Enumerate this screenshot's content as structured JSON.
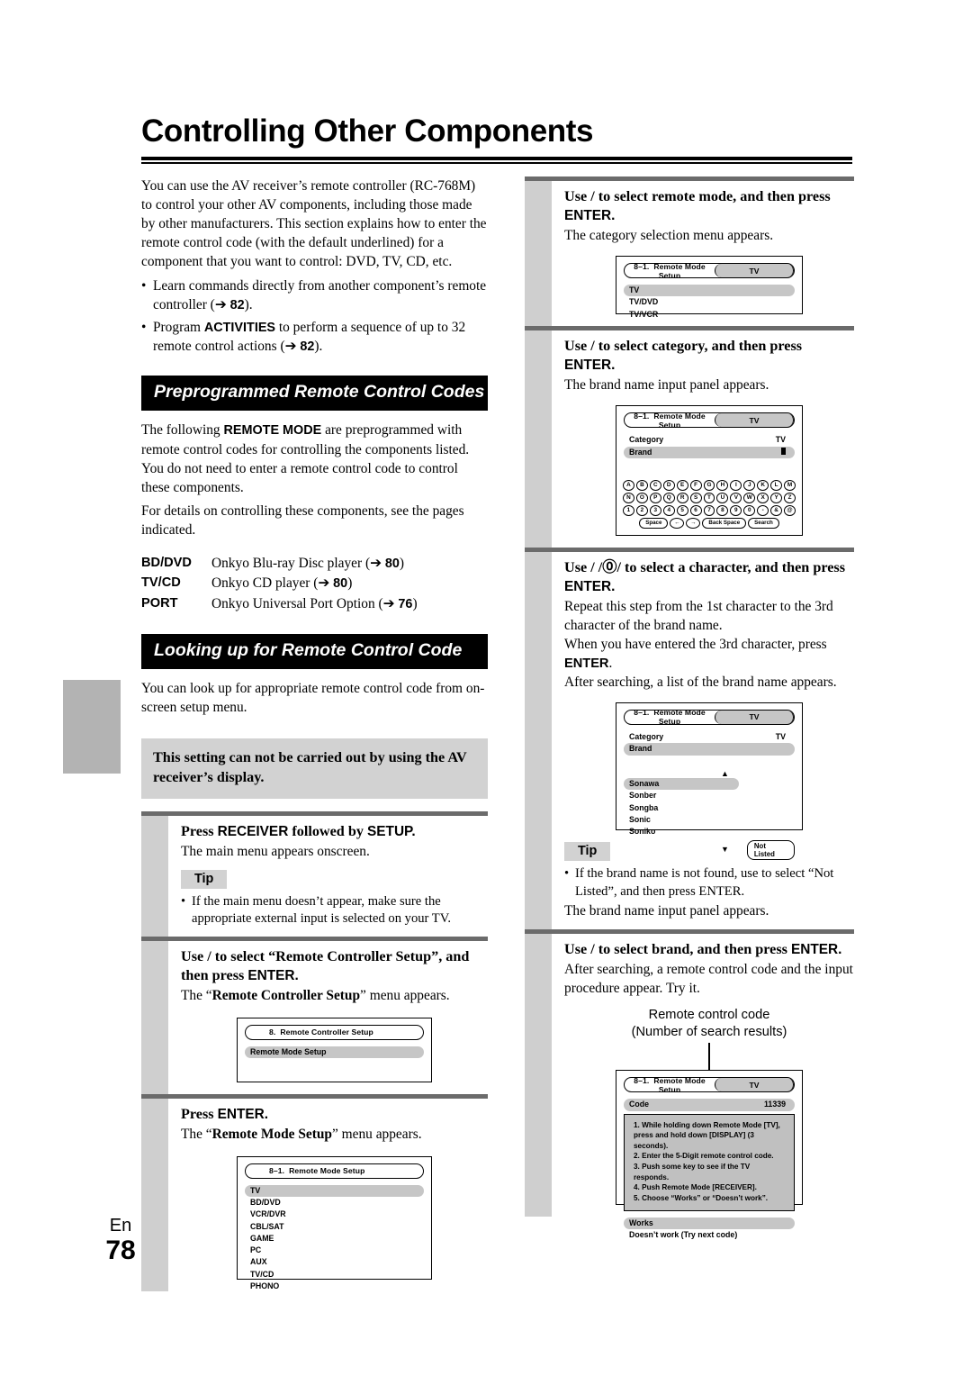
{
  "page": {
    "title": "Controlling Other Components",
    "footer_lang": "En",
    "footer_number": "78"
  },
  "intro": {
    "paragraph": "You can use the AV receiver’s remote controller (RC-768M) to control your other AV components, including those made by other manufacturers. This section explains how to enter the remote control code (with the default underlined) for a component that you want to control: DVD, TV, CD, etc.",
    "bullets": [
      {
        "text_before": "Learn commands directly from another component’s remote controller (",
        "arrow": "➔",
        "page": "82",
        "text_after": ")."
      },
      {
        "text_before": "Program ",
        "bold": "ACTIVITIES",
        "text_mid": " to perform a sequence of up to 32 remote control actions (",
        "arrow": "➔",
        "page": "82",
        "text_after": ")."
      }
    ]
  },
  "section_preprogrammed": {
    "heading": "Preprogrammed Remote Control Codes",
    "p1_a": "The following ",
    "p1_b": "REMOTE MODE",
    "p1_c": " are preprogrammed with remote control codes for controlling the components listed. You do not need to enter a remote control code to control these components.",
    "p2": "For details on controlling these components, see the pages indicated.",
    "modes": [
      {
        "key": "BD/DVD",
        "desc": "Onkyo Blu-ray Disc player (",
        "arrow": "➔",
        "page": "80",
        "close": ")"
      },
      {
        "key": "TV/CD",
        "desc": "Onkyo CD player (",
        "arrow": "➔",
        "page": "80",
        "close": ")"
      },
      {
        "key": "PORT",
        "desc": "Onkyo Universal Port Option (",
        "arrow": "➔",
        "page": "76",
        "close": ")"
      }
    ]
  },
  "section_lookup": {
    "heading": "Looking up for Remote Control Code",
    "intro": "You can look up for appropriate remote control code from on-screen setup menu.",
    "note": "This setting can not be carried out by using the AV receiver’s display."
  },
  "steps": {
    "step1": {
      "title_a": "Press ",
      "title_b": "RECEIVER",
      "title_c": " followed by ",
      "title_d": "SETUP.",
      "body": "The main menu appears onscreen.",
      "tip_label": "Tip",
      "tip_items": [
        "If the main menu doesn’t appear, make sure the appropriate external input is selected on your TV."
      ]
    },
    "step2": {
      "title_a": "Use   /   to select “Remote Controller Setup”, and then press ",
      "title_b": "ENTER.",
      "body_a": "The “",
      "body_b": "Remote Controller Setup",
      "body_c": "” menu appears.",
      "osd": {
        "header_num": "8.",
        "header_title": "Remote Controller Setup",
        "items": [
          "Remote Mode Setup"
        ]
      }
    },
    "step3": {
      "title_a": "Press ",
      "title_b": "ENTER.",
      "body_a": "The “",
      "body_b": "Remote Mode Setup",
      "body_c": "” menu appears.",
      "osd": {
        "header_num": "8–1.",
        "header_title": "Remote Mode Setup",
        "items": [
          "TV",
          "BD/DVD",
          "VCR/DVR",
          "CBL/SAT",
          "GAME",
          "PC",
          "AUX",
          "TV/CD",
          "PHONO"
        ]
      }
    },
    "step4": {
      "title_a": "Use   /   to select remote mode, and then press ",
      "title_b": "ENTER.",
      "body": "The category selection menu appears.",
      "osd": {
        "header_num": "8–1.",
        "header_title": "Remote Mode Setup",
        "chip": "TV",
        "items": [
          "TV",
          "TV/DVD",
          "TV/VCR"
        ]
      }
    },
    "step5": {
      "title_a": "Use   /   to select category, and then press ",
      "title_b": "ENTER.",
      "body": "The brand name input panel appears.",
      "osd": {
        "header_num": "8–1.",
        "header_title": "Remote Mode Setup",
        "chip": "TV",
        "row_category_label": "Category",
        "row_category_value": "TV",
        "row_brand_label": "Brand",
        "row_brand_value": "",
        "keyboard_row1": [
          "A",
          "B",
          "C",
          "D",
          "E",
          "F",
          "G",
          "H",
          "I",
          "J",
          "K",
          "L",
          "M"
        ],
        "keyboard_row2": [
          "N",
          "O",
          "P",
          "Q",
          "R",
          "S",
          "T",
          "U",
          "V",
          "W",
          "X",
          "Y",
          "Z"
        ],
        "keyboard_row3": [
          "1",
          "2",
          "3",
          "4",
          "5",
          "6",
          "7",
          "8",
          "9",
          "0",
          "-",
          "&",
          "@"
        ],
        "keyboard_row4": [
          "Space",
          "←",
          "→",
          "Back Space",
          "Search"
        ]
      }
    },
    "step6": {
      "title_a": "Use   /   /⓪/   to select a character, and then press ",
      "title_b": "ENTER.",
      "body1": "Repeat this step from the 1st character to the 3rd character of the brand name.",
      "body2_a": "When you have entered the 3rd character, press ",
      "body2_b": "ENTER",
      "body2_c": ".",
      "body3": "After searching, a list of the brand name appears.",
      "osd": {
        "header_num": "8–1.",
        "header_title": "Remote Mode Setup",
        "chip": "TV",
        "row_category_label": "Category",
        "row_category_value": "TV",
        "row_brand_label": "Brand",
        "brands": [
          "Sonawa",
          "Sonber",
          "Songba",
          "Sonic",
          "Soniko"
        ],
        "not_listed": "Not Listed",
        "up_arrow": "▲",
        "down_arrow": "▼"
      },
      "tip_label": "Tip",
      "tip_a": "If the brand name is not found, use      to select “",
      "tip_b": "Not Listed",
      "tip_c": "”, and then press ",
      "tip_d": "ENTER",
      "tip_e": ".",
      "after_tip": "The brand name input panel appears."
    },
    "step7": {
      "title_a": "Use   /   to select brand, and then press ",
      "title_b": "ENTER.",
      "body": "After searching, a remote control code and the input procedure appear. Try it.",
      "callout_line1": "Remote control code",
      "callout_line2": "(Number of search results)",
      "osd": {
        "header_num": "8–1.",
        "header_title": "Remote Mode Setup",
        "chip": "TV",
        "code_label": "Code",
        "code_value": "11339",
        "instructions": [
          "1.  While holding down Remote Mode [TV],",
          "press and hold down [DISPLAY] (3 seconds).",
          "2.  Enter the 5-Digit remote control code.",
          "3.  Push some key to see if the TV responds.",
          "4.  Push Remote Mode [RECEIVER].",
          "5.  Choose “Works” or “Doesn’t work”."
        ],
        "result_works": "Works",
        "result_fail": "Doesn’t work (Try next code)"
      }
    }
  },
  "colors": {
    "heading_bg": "#000000",
    "note_bg": "#d2d2d2",
    "step_gutter": "#cfcfcf",
    "rule": "#6b6b6b",
    "osd_highlight": "#c6c6c6",
    "edge_tab": "#b3b3b3"
  }
}
